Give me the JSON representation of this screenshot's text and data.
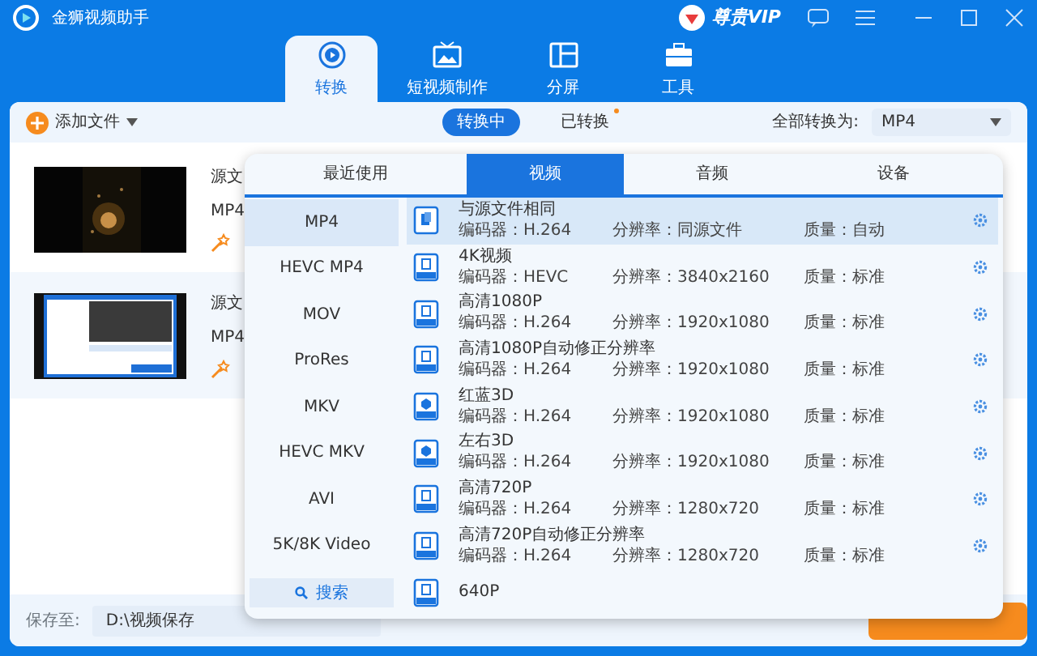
{
  "app": {
    "title": "金狮视频助手",
    "vip": "尊贵VIP"
  },
  "nav_tabs": [
    {
      "label": "转换",
      "selected": true,
      "kind": "convert"
    },
    {
      "label": "短视频制作",
      "selected": false,
      "kind": "tv"
    },
    {
      "label": "分屏",
      "selected": false,
      "kind": "split"
    },
    {
      "label": "工具",
      "selected": false,
      "kind": "toolbox"
    }
  ],
  "toolbar": {
    "add_files": "添加文件",
    "status_tabs": [
      {
        "label": "转换中",
        "selected": true,
        "dot": false
      },
      {
        "label": "已转换",
        "selected": false,
        "dot": true
      }
    ],
    "convert_all_label": "全部转换为:",
    "convert_all_value": "MP4"
  },
  "files": [
    {
      "source": "源文",
      "format": "MP4",
      "selected": false,
      "kind": "dark"
    },
    {
      "source": "源文",
      "format": "MP4",
      "selected": true,
      "kind": "screen"
    }
  ],
  "format_popup": {
    "tabs": [
      {
        "label": "最近使用",
        "selected": false
      },
      {
        "label": "视频",
        "selected": true
      },
      {
        "label": "音频",
        "selected": false
      },
      {
        "label": "设备",
        "selected": false
      }
    ],
    "formats": [
      {
        "label": "MP4",
        "selected": true
      },
      {
        "label": "HEVC MP4",
        "selected": false
      },
      {
        "label": "MOV",
        "selected": false
      },
      {
        "label": "ProRes",
        "selected": false
      },
      {
        "label": "MKV",
        "selected": false
      },
      {
        "label": "HEVC MKV",
        "selected": false
      },
      {
        "label": "AVI",
        "selected": false
      },
      {
        "label": "5K/8K Video",
        "selected": false
      }
    ],
    "search": "搜索",
    "presets": [
      {
        "name": "与源文件相同",
        "encoder": "编码器：H.264",
        "resolution": "分辨率：同源文件",
        "quality": "质量：自动",
        "selected": true,
        "kind": "file"
      },
      {
        "name": "4K视频",
        "encoder": "编码器：HEVC",
        "resolution": "分辨率：3840x2160",
        "quality": "质量：标准",
        "selected": false,
        "kind": "res"
      },
      {
        "name": "高清1080P",
        "encoder": "编码器：H.264",
        "resolution": "分辨率：1920x1080",
        "quality": "质量：标准",
        "selected": false,
        "kind": "res"
      },
      {
        "name": "高清1080P自动修正分辨率",
        "encoder": "编码器：H.264",
        "resolution": "分辨率：1920x1080",
        "quality": "质量：标准",
        "selected": false,
        "kind": "res"
      },
      {
        "name": "红蓝3D",
        "encoder": "编码器：H.264",
        "resolution": "分辨率：1920x1080",
        "quality": "质量：标准",
        "selected": false,
        "kind": "stereo"
      },
      {
        "name": "左右3D",
        "encoder": "编码器：H.264",
        "resolution": "分辨率：1920x1080",
        "quality": "质量：标准",
        "selected": false,
        "kind": "stereo"
      },
      {
        "name": "高清720P",
        "encoder": "编码器：H.264",
        "resolution": "分辨率：1280x720",
        "quality": "质量：标准",
        "selected": false,
        "kind": "res"
      },
      {
        "name": "高清720P自动修正分辨率",
        "encoder": "编码器：H.264",
        "resolution": "分辨率：1280x720",
        "quality": "质量：标准",
        "selected": false,
        "kind": "res"
      },
      {
        "name": "640P",
        "selected": false,
        "kind": "res"
      }
    ]
  },
  "save": {
    "label": "保存至:",
    "path": "D:\\视频保存"
  }
}
